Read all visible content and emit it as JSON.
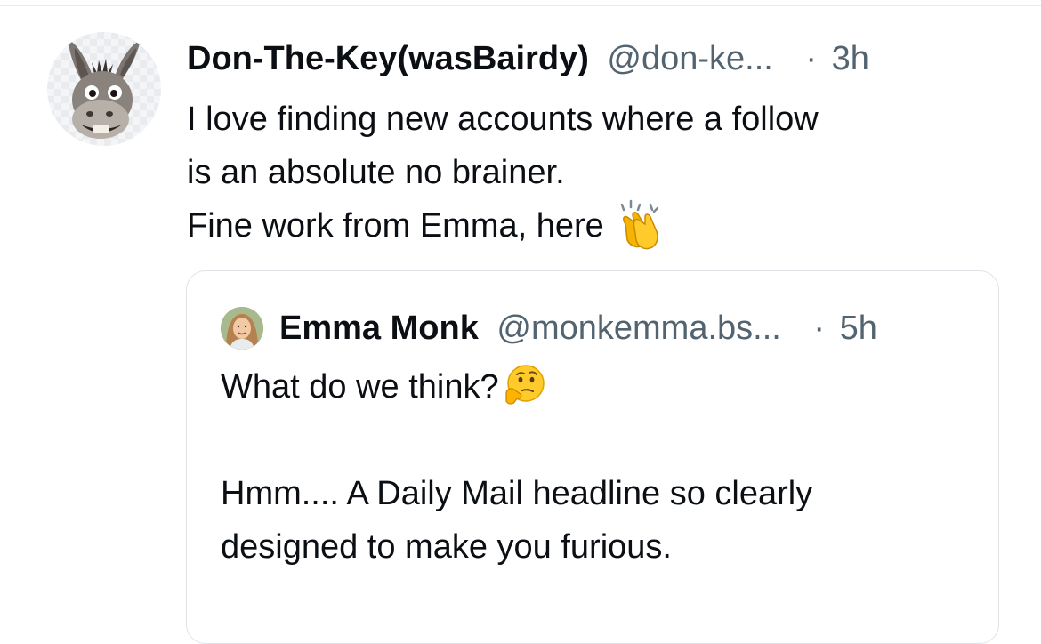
{
  "post": {
    "author_name": "Don-The-Key(wasBairdy)",
    "handle": "@don-ke...",
    "separator": "·",
    "time": "3h",
    "lines": [
      "I love finding new accounts where a follow",
      "is an absolute no brainer.",
      "Fine work from Emma, here"
    ],
    "emoji": "clapping-hands-icon"
  },
  "quote": {
    "author_name": "Emma Monk",
    "handle": "@monkemma.bs...",
    "separator": "·",
    "time": "5h",
    "line1": "What do we think?",
    "line1_emoji": "thinking-face-icon",
    "lines": [
      "Hmm.... A Daily Mail headline so clearly",
      "designed to make you furious."
    ]
  },
  "colors": {
    "text": "#0b0f14",
    "muted": "#536471",
    "border": "#dfe3e8"
  }
}
